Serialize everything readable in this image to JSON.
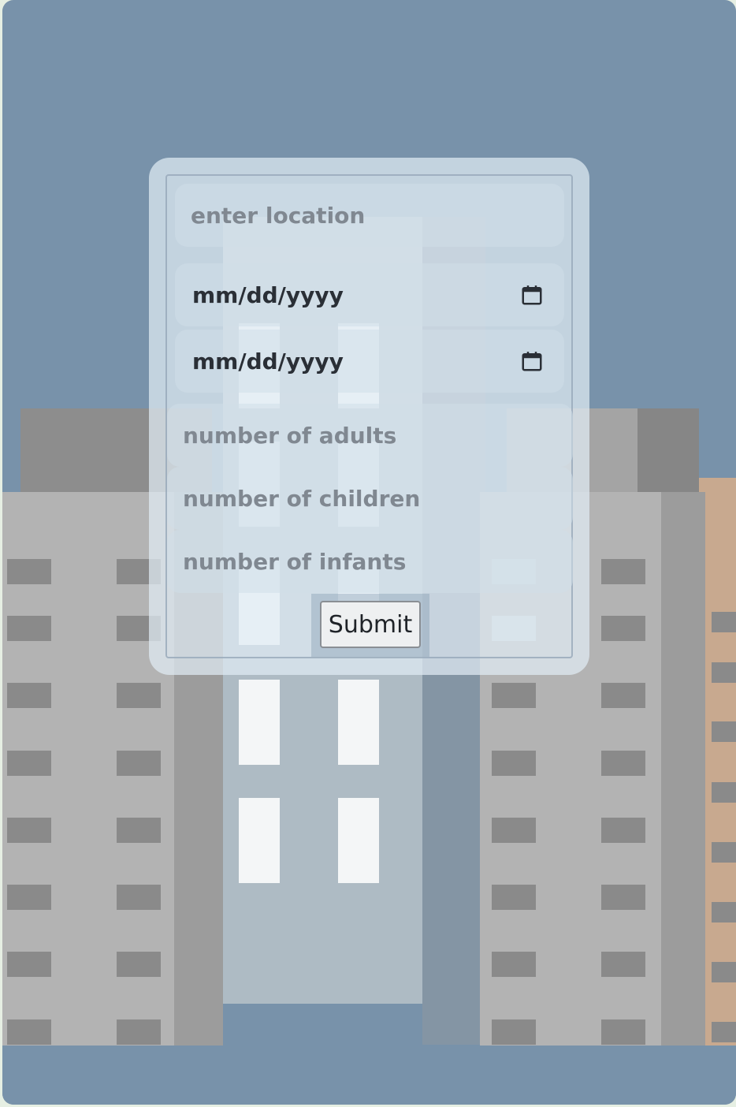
{
  "form": {
    "location_placeholder": "enter location",
    "checkin_value": "mm/dd/yyyy",
    "checkout_value": "mm/dd/yyyy",
    "adults_placeholder": "number of adults",
    "children_placeholder": "number of children",
    "infants_placeholder": "number of infants",
    "submit_label": "Submit"
  },
  "icons": {
    "checkin_icon": "calendar-icon",
    "checkout_icon": "calendar-icon"
  },
  "colors": {
    "sky": "#7892aa",
    "building_gray": "#b3b3b3",
    "building_dark": "#8a8a8a",
    "center_building": "#aebbc4",
    "brick": "#c8a98f"
  }
}
